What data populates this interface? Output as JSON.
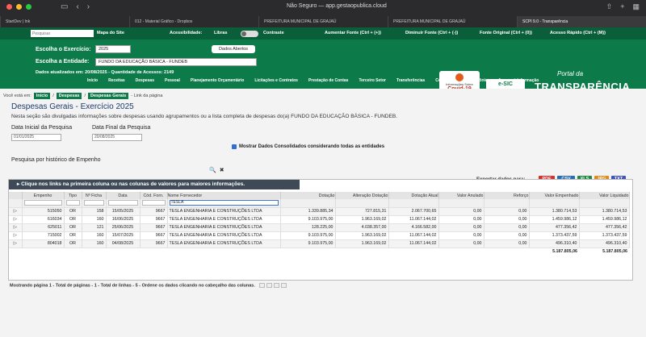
{
  "browser": {
    "url": "Não Seguro — app.gestaopublica.cloud",
    "tabs": [
      {
        "label": "StartDev | Ink",
        "active": false
      },
      {
        "label": "012 - Material Gráfico - Dropbox",
        "active": false
      },
      {
        "label": "PREFEITURA MUNICIPAL DE GRAJAÚ",
        "active": false
      },
      {
        "label": "PREFEITURA MUNICIPAL DE GRAJAÚ",
        "active": false
      },
      {
        "label": "SCPI 9.0 - Transparência",
        "active": true
      }
    ]
  },
  "topbar": {
    "search_placeholder": "Pesquisar",
    "mapa": "Mapa do Site",
    "acessibilidade": "Acessibilidade:",
    "libras": "Libras",
    "contraste": "Contraste",
    "aumentar": "Aumentar Fonte (Ctrl + (+))",
    "diminuir": "Diminuir Fonte (Ctrl + (-))",
    "original": "Fonte Original (Ctrl + (0))",
    "rapido": "Acesso Rápido (Ctrl + (M))"
  },
  "header": {
    "exercicio_label": "Escolha o Exercício:",
    "exercicio_value": "2025",
    "entidade_label": "Escolha a Entidade:",
    "entidade_value": "FUNDO DA EDUCAÇÃO BÁSICA - FUNDEB",
    "dados_abertos": "Dados Abertos",
    "updated": "Dados atualizados em: 20/08/2025 - Quantidade de Acessos: 2149",
    "menu": [
      "Início",
      "Receitas",
      "Despesas",
      "Pessoal",
      "Planejamento Orçamentário",
      "Licitações e Contratos",
      "Prestação de Contas",
      "Terceiro Setor",
      "Transferências",
      "Convênios",
      "Patrimônio",
      "Acesso à Informação"
    ],
    "covid_small": "Informações Sobre",
    "covid_big": "Covid-19",
    "esic": "e-SIC",
    "portal_da": "Portal da",
    "portal_title": "TRANSPARÊNCIA"
  },
  "breadcrumb": {
    "label": "Você está em:",
    "items": [
      "Início",
      "Despesas",
      "Despesas Gerais"
    ],
    "tail": "- Link da página"
  },
  "page": {
    "title": "Despesas Gerais - Exercício 2025",
    "description": "Nesta seção são divulgadas informações sobre despesas usando agrupamentos ou a lista completa de despesas do(a) FUNDO DA EDUCAÇÃO BÁSICA - FUNDEB.",
    "data_inicial_label": "Data Inicial da Pesquisa",
    "data_inicial_value": "01/01/2025",
    "data_final_label": "Data Final da Pesquisa",
    "data_final_value": "20/08/2025",
    "consolidado": "Mostrar Dados Consolidados considerando todas as entidades",
    "historico": "Pesquisa por histórico de Empenho"
  },
  "export": {
    "label": "Exportar dados para:",
    "formats": [
      {
        "label": "PDF",
        "color": "#d0312d"
      },
      {
        "label": "CSV",
        "color": "#2b6cb0"
      },
      {
        "label": "XLS",
        "color": "#1e8a44"
      },
      {
        "label": "JPG",
        "color": "#e08a1e"
      },
      {
        "label": "TXT",
        "color": "#3f51b5"
      }
    ]
  },
  "grid": {
    "heading": "Clique nos links na primeira coluna ou nas colunas de valores para maiores informações.",
    "columns": [
      "Empenho",
      "Tipo",
      "Nº Ficha",
      "Data",
      "Cód. Forn.",
      "Nome Fornecedor",
      "Dotação",
      "Alteração Dotação",
      "Dotação Atual",
      "Valor Anulado",
      "Reforço",
      "Valor Empenhado",
      "Valor Liquidado"
    ],
    "filter_fornecedor": "TESLA",
    "rows": [
      {
        "empenho": "515050",
        "tipo": "OR",
        "ficha": "158",
        "data": "15/05/2025",
        "cod": "9667",
        "nome": "TESLA ENGENHARIA E CONSTRUÇÕES LTDA",
        "dotacao": "1.339.885,34",
        "alteracao": "727.815,31",
        "atual": "2.067.700,65",
        "anulado": "0,00",
        "reforco": "0,00",
        "empenhado": "1.380.714,53",
        "liquidado": "1.380.714,53"
      },
      {
        "empenho": "616034",
        "tipo": "OR",
        "ficha": "160",
        "data": "16/06/2025",
        "cod": "9667",
        "nome": "TESLA ENGENHARIA E CONSTRUÇÕES LTDA",
        "dotacao": "9.103.975,00",
        "alteracao": "1.963.169,02",
        "atual": "11.067.144,02",
        "anulado": "0,00",
        "reforco": "0,00",
        "empenhado": "1.459.986,12",
        "liquidado": "1.459.986,12"
      },
      {
        "empenho": "625011",
        "tipo": "OR",
        "ficha": "121",
        "data": "25/06/2025",
        "cod": "9667",
        "nome": "TESLA ENGENHARIA E CONSTRUÇÕES LTDA",
        "dotacao": "128.225,00",
        "alteracao": "4.038.357,00",
        "atual": "4.166.582,00",
        "anulado": "0,00",
        "reforco": "0,00",
        "empenhado": "477.356,42",
        "liquidado": "477.356,42"
      },
      {
        "empenho": "715002",
        "tipo": "OR",
        "ficha": "160",
        "data": "15/07/2025",
        "cod": "9667",
        "nome": "TESLA ENGENHARIA E CONSTRUÇÕES LTDA",
        "dotacao": "9.103.975,00",
        "alteracao": "1.963.169,02",
        "atual": "11.067.144,02",
        "anulado": "0,00",
        "reforco": "0,00",
        "empenhado": "1.373.437,59",
        "liquidado": "1.373.437,59"
      },
      {
        "empenho": "804018",
        "tipo": "OR",
        "ficha": "160",
        "data": "04/08/2025",
        "cod": "9667",
        "nome": "TESLA ENGENHARIA E CONSTRUÇÕES LTDA",
        "dotacao": "9.103.975,00",
        "alteracao": "1.963.169,02",
        "atual": "11.067.144,02",
        "anulado": "0,00",
        "reforco": "0,00",
        "empenhado": "496.310,40",
        "liquidado": "496.310,40"
      }
    ],
    "total_empenhado": "5.187.805,06",
    "total_liquidado": "5.187.805,06"
  },
  "footer": {
    "text": "Mostrando página 1 - Total de páginas - 1 - Total de linhas - 5 - Ordene os dados clicando no cabeçalho das colunas."
  }
}
